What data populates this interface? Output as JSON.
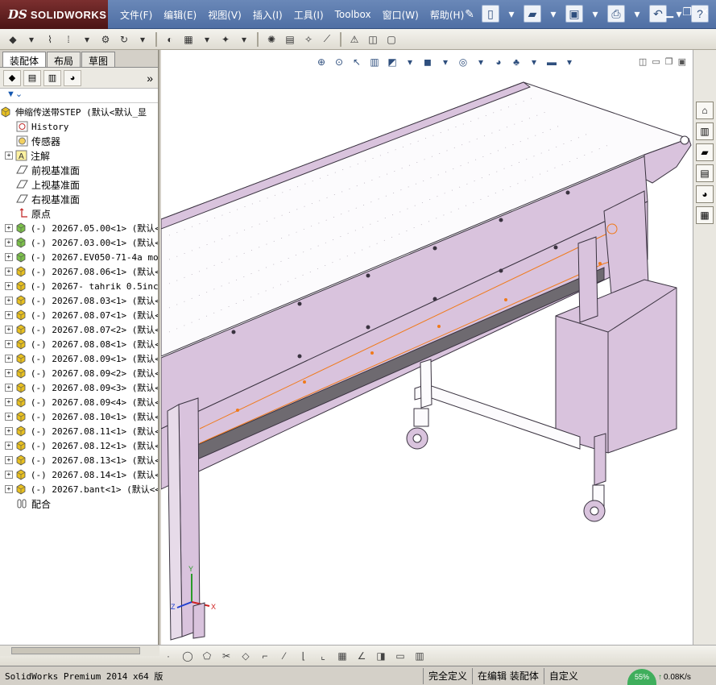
{
  "app": {
    "logo_prefix": "DS",
    "logo_name": "SOLIDWORKS"
  },
  "menu": [
    {
      "id": "file",
      "label": "文件(F)"
    },
    {
      "id": "edit",
      "label": "编辑(E)"
    },
    {
      "id": "view",
      "label": "视图(V)"
    },
    {
      "id": "insert",
      "label": "插入(I)"
    },
    {
      "id": "tools",
      "label": "工具(I)"
    },
    {
      "id": "toolbox",
      "label": "Toolbox"
    },
    {
      "id": "window",
      "label": "窗口(W)"
    },
    {
      "id": "help",
      "label": "帮助(H)"
    }
  ],
  "panel": {
    "tabs": [
      {
        "id": "assembly",
        "label": "装配体",
        "active": true
      },
      {
        "id": "layout",
        "label": "布局",
        "active": false
      },
      {
        "id": "sketch",
        "label": "草图",
        "active": false
      }
    ],
    "more": "»"
  },
  "tree": {
    "root": "伸缩传送带STEP  (默认<默认_显",
    "history": "History",
    "sensors": "传感器",
    "annotations": "注解",
    "front_plane": "前视基准面",
    "top_plane": "上视基准面",
    "right_plane": "右视基准面",
    "origin": "原点",
    "components": [
      {
        "label": "(-) 20267.05.00<1> (默认<",
        "kind": "asm"
      },
      {
        "label": "(-) 20267.03.00<1> (默认<",
        "kind": "asm"
      },
      {
        "label": "(-) 20267.EV050-71-4a mon",
        "kind": "asm"
      },
      {
        "label": "(-) 20267.08.06<1> (默认<",
        "kind": "part"
      },
      {
        "label": "(-) 20267- tahrik 0.5inch",
        "kind": "part"
      },
      {
        "label": "(-) 20267.08.03<1> (默认<",
        "kind": "part"
      },
      {
        "label": "(-) 20267.08.07<1> (默认<",
        "kind": "part"
      },
      {
        "label": "(-) 20267.08.07<2> (默认<",
        "kind": "part"
      },
      {
        "label": "(-) 20267.08.08<1> (默认<",
        "kind": "part"
      },
      {
        "label": "(-) 20267.08.09<1> (默认<",
        "kind": "part"
      },
      {
        "label": "(-) 20267.08.09<2> (默认<",
        "kind": "part"
      },
      {
        "label": "(-) 20267.08.09<3> (默认<",
        "kind": "part"
      },
      {
        "label": "(-) 20267.08.09<4> (默认<",
        "kind": "part"
      },
      {
        "label": "(-) 20267.08.10<1> (默认<",
        "kind": "part"
      },
      {
        "label": "(-) 20267.08.11<1> (默认<",
        "kind": "part"
      },
      {
        "label": "(-) 20267.08.12<1> (默认<",
        "kind": "part"
      },
      {
        "label": "(-) 20267.08.13<1> (默认<",
        "kind": "part"
      },
      {
        "label": "(-) 20267.08.14<1> (默认<",
        "kind": "part"
      },
      {
        "label": "(-) 20267.bant<1> (默认<<",
        "kind": "part"
      }
    ],
    "mates": "配合"
  },
  "triad": {
    "x": "X",
    "y": "Y",
    "z": "Z"
  },
  "status": {
    "product": "SolidWorks Premium 2014 x64 版",
    "constraint": "完全定义",
    "mode": "在编辑 装配体",
    "custom": "自定义"
  },
  "network": {
    "percent": "55%",
    "speed": "0.08K/s"
  },
  "colors": {
    "frame_fill": "#d9c3dd",
    "frame_stroke": "#3a3340",
    "belt_top": "#fcfbfd",
    "selection_edge": "#f07a1a",
    "title_gradient_top": "#6a88b8"
  }
}
